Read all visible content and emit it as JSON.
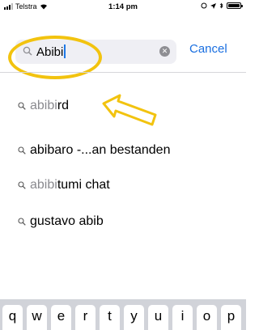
{
  "status_bar": {
    "carrier": "Telstra",
    "time": "1:14 pm"
  },
  "search": {
    "query": "Abibi",
    "cancel_label": "Cancel"
  },
  "suggestions": [
    {
      "prefix": "abibi",
      "suffix": "rd"
    },
    {
      "prefix": "",
      "suffix": "abibaro -...an bestanden"
    },
    {
      "prefix": "abibi",
      "suffix": "tumi chat"
    },
    {
      "prefix": "",
      "suffix": "gustavo abib"
    }
  ],
  "keyboard": {
    "row1": [
      "q",
      "w",
      "e",
      "r",
      "t",
      "y",
      "u",
      "i",
      "o",
      "p"
    ]
  },
  "colors": {
    "accent": "#1a6fe0",
    "highlight": "#f2c30f",
    "muted_text": "#8a8a8f"
  }
}
